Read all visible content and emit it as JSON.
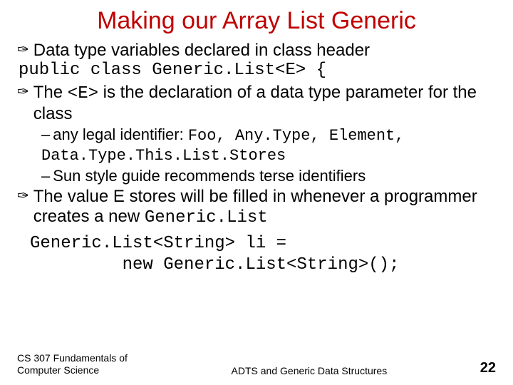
{
  "title": "Making our Array List Generic",
  "bullets": {
    "b1": "Data type variables declared in class header",
    "code1": "public class Generic.List<E> {",
    "b2_a": "The ",
    "b2_code": "<E>",
    "b2_b": " is the declaration of a data type parameter for the class",
    "sub1_a": "any legal identifier: ",
    "sub1_code": "Foo, Any.Type, Element, Data.Type.This.List.Stores",
    "sub2": "Sun style guide recommends terse identifiers",
    "b3_a": "The value E stores will be filled in whenever a programmer creates a new ",
    "b3_code": "Generic.List",
    "code2": "Generic.List<String> li =\n         new Generic.List<String>();"
  },
  "footer": {
    "left": "CS 307 Fundamentals of Computer Science",
    "center": "ADTS and Generic Data Structures",
    "page": "22"
  }
}
